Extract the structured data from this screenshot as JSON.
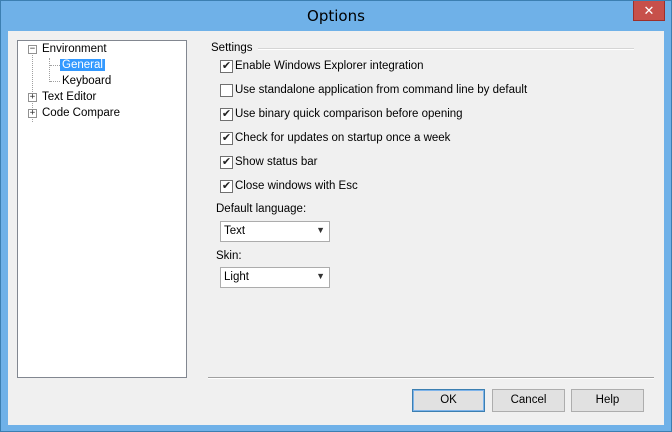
{
  "window": {
    "title": "Options",
    "close_glyph": "✕"
  },
  "tree": {
    "environment": {
      "label": "Environment",
      "expander": "−"
    },
    "general": {
      "label": "General"
    },
    "keyboard": {
      "label": "Keyboard"
    },
    "text_editor": {
      "label": "Text Editor",
      "expander": "+"
    },
    "code_compare": {
      "label": "Code Compare",
      "expander": "+"
    }
  },
  "settings": {
    "heading": "Settings",
    "options": [
      {
        "label": "Enable Windows Explorer integration",
        "checked": true,
        "mark": "✔"
      },
      {
        "label": "Use standalone application from command line by default",
        "checked": false,
        "mark": ""
      },
      {
        "label": "Use binary quick comparison before opening",
        "checked": true,
        "mark": "✔"
      },
      {
        "label": "Check for updates on startup once a week",
        "checked": true,
        "mark": "✔"
      },
      {
        "label": "Show status bar",
        "checked": true,
        "mark": "✔"
      },
      {
        "label": "Close windows with Esc",
        "checked": true,
        "mark": "✔"
      }
    ],
    "language": {
      "label": "Default language:",
      "value": "Text"
    },
    "skin": {
      "label": "Skin:",
      "value": "Light"
    },
    "dropdown_glyph": "▼"
  },
  "buttons": {
    "ok": "OK",
    "cancel": "Cancel",
    "help": "Help"
  },
  "colors": {
    "titlebar": "#6fb1e8",
    "selection": "#3399ff",
    "close_button": "#c7504a"
  }
}
